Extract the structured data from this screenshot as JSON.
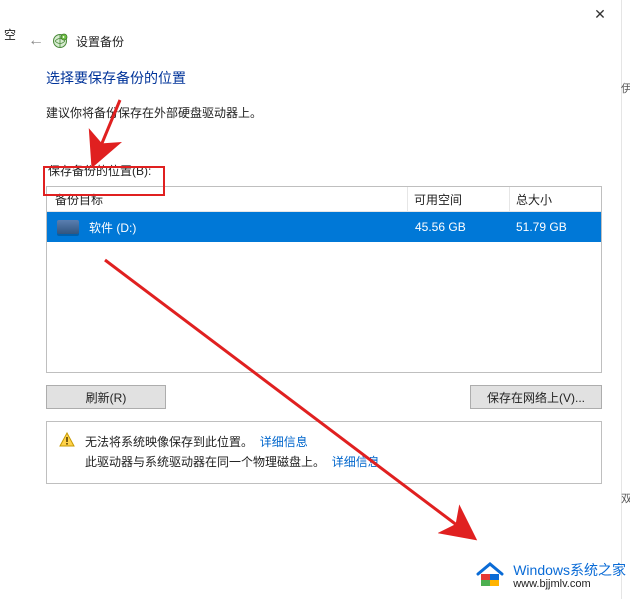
{
  "left_fragment": {
    "text": "空"
  },
  "titlebar": {
    "close_glyph": "✕"
  },
  "top_right_partial": ">",
  "right_edge_markers": [
    "伊",
    "双"
  ],
  "header": {
    "back_glyph": "←",
    "title": "设置备份"
  },
  "main": {
    "instruction": "选择要保存备份的位置",
    "subtext": "建议你将备份保存在外部硬盘驱动器上。",
    "location_label": "保存备份的位置(B):",
    "table": {
      "headers": {
        "target": "备份目标",
        "available": "可用空间",
        "total": "总大小"
      },
      "rows": [
        {
          "name": "软件 (D:)",
          "available": "45.56 GB",
          "total": "51.79 GB",
          "selected": true
        }
      ]
    },
    "buttons": {
      "refresh": "刷新(R)",
      "save_network": "保存在网络上(V)..."
    },
    "warning": {
      "line1_text": "无法将系统映像保存到此位置。",
      "line1_link": "详细信息",
      "line2_text": "此驱动器与系统驱动器在同一个物理磁盘上。",
      "line2_link": "详细信息"
    }
  },
  "watermark": {
    "brand": "Windows系统之家",
    "url": "www.bjjmlv.com"
  },
  "colors": {
    "selection": "#0078d7",
    "instruction": "#003399",
    "red": "#e02020",
    "link": "#0066cc"
  }
}
